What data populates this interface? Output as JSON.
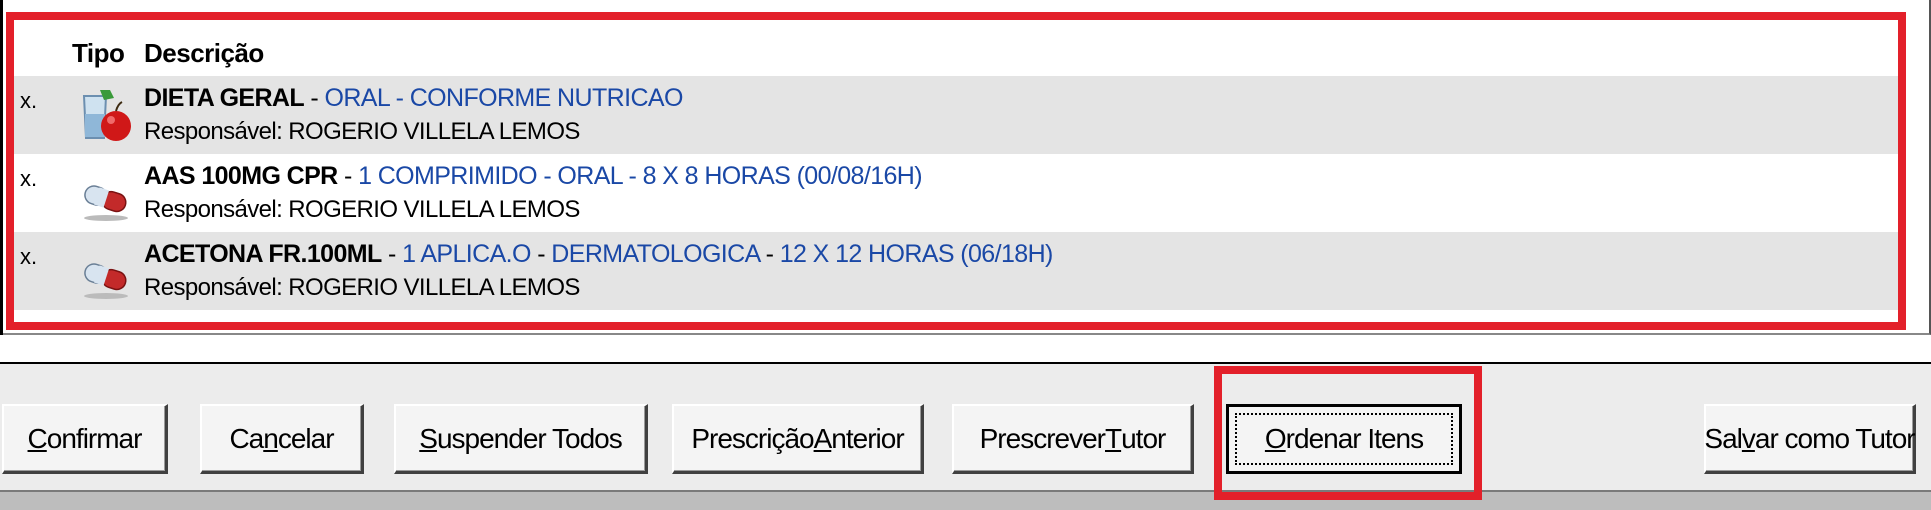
{
  "list": {
    "header": {
      "tipo": "Tipo",
      "descricao": "Descrição"
    },
    "items": [
      {
        "marker": "x.",
        "icon": "diet-icon",
        "name": "DIETA GERAL",
        "d1": "ORAL",
        "d2": "CONFORME NUTRICAO",
        "d3": "",
        "d4": "",
        "responsavel": "Responsável: ROGERIO VILLELA LEMOS"
      },
      {
        "marker": "x.",
        "icon": "capsule-icon",
        "name": "AAS 100MG CPR",
        "d1": "1 COMPRIMIDO",
        "d2": "ORAL",
        "d3": "8 X 8 HORAS (00/08/16H)",
        "d4": "",
        "responsavel": "Responsável: ROGERIO VILLELA LEMOS"
      },
      {
        "marker": "x.",
        "icon": "capsule-icon",
        "name": "ACETONA FR.100ML",
        "d1": "1 APLICA.O",
        "d2": "DERMATOLOGICA",
        "d3": "12 X 12 HORAS (06/18H)",
        "d4": "",
        "responsavel": "Responsável: ROGERIO VILLELA LEMOS"
      }
    ],
    "separator": " - "
  },
  "buttons": {
    "confirmar": {
      "pre": "",
      "key": "C",
      "post": "onfirmar"
    },
    "cancelar": {
      "pre": "Ca",
      "key": "n",
      "post": "celar"
    },
    "suspender": {
      "pre": "",
      "key": "S",
      "post": "uspender Todos"
    },
    "prescricao": {
      "pre": "Prescrição ",
      "key": "A",
      "post": "nterior"
    },
    "prescrever": {
      "pre": "Prescrever ",
      "key": "T",
      "post": "utor"
    },
    "ordenar": {
      "pre": "",
      "key": "O",
      "post": "rdenar Itens"
    },
    "salvar": {
      "pre": "Sal",
      "key": "v",
      "post": "ar como Tutor"
    }
  },
  "colors": {
    "highlight": "#e3202a",
    "detail_text": "#1a48a6",
    "row_shade": "#e4e4e4"
  }
}
